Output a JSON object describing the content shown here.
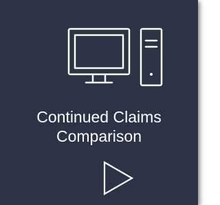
{
  "card": {
    "title_line1": "Continued Claims",
    "title_line2": "Comparison",
    "icon": "desktop-computer-icon",
    "action_icon": "play-icon",
    "colors": {
      "background": "#2c3346",
      "foreground": "#ffffff"
    }
  }
}
